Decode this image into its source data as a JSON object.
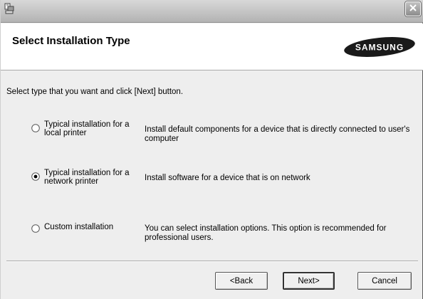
{
  "header": {
    "title": "Select Installation Type",
    "logo_text": "SAMSUNG"
  },
  "instructions": "Select type that you want and click [Next] button.",
  "options": [
    {
      "label_line1": "Typical installation for a",
      "label_line2": "local printer",
      "desc_line1": "Install default components for a device that is directly connected to user's",
      "desc_line2": "computer",
      "selected": false
    },
    {
      "label_line1": "Typical installation for a",
      "label_line2": "network printer",
      "desc_line1": "Install software for a device that is on network",
      "desc_line2": "",
      "selected": true
    },
    {
      "label_line1": "Custom installation",
      "label_line2": "",
      "desc_line1": "You can select installation options. This option is recommended for",
      "desc_line2": "professional users.",
      "selected": false
    }
  ],
  "buttons": {
    "back": "<Back",
    "next": "Next>",
    "cancel": "Cancel"
  },
  "icons": {
    "app": "installer-app-icon",
    "close": "close-icon"
  }
}
